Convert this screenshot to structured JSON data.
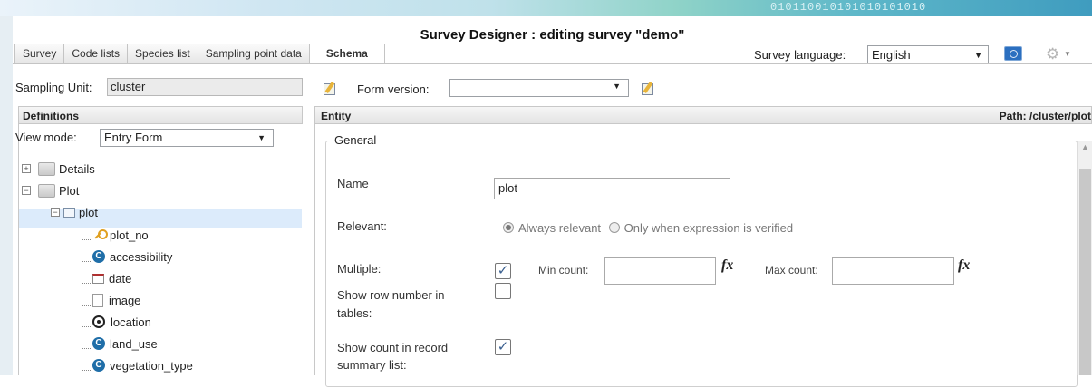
{
  "banner": {
    "digits": "010110010101010101010"
  },
  "window_title": "Survey Designer : editing survey \"demo\"",
  "tabs": [
    {
      "label": "Survey"
    },
    {
      "label": "Code lists"
    },
    {
      "label": "Species list"
    },
    {
      "label": "Sampling point data"
    },
    {
      "label": "Schema"
    }
  ],
  "active_tab": "Schema",
  "language": {
    "label": "Survey language:",
    "value": "English"
  },
  "sampling_unit": {
    "label": "Sampling Unit:",
    "value": "cluster"
  },
  "form_version": {
    "label": "Form version:",
    "value": ""
  },
  "definitions": {
    "header": "Definitions",
    "view_mode_label": "View mode:",
    "view_mode_value": "Entry Form",
    "tree": {
      "details": "Details",
      "plot_group": "Plot",
      "plot_entity": "plot",
      "children": [
        "plot_no",
        "accessibility",
        "date",
        "image",
        "location",
        "land_use",
        "vegetation_type"
      ],
      "child_icons": [
        "key-icon",
        "code-icon",
        "date-icon",
        "file-icon",
        "location-icon",
        "code-icon",
        "code-icon"
      ]
    }
  },
  "entity": {
    "header": "Entity",
    "path": "Path: /cluster/plot",
    "section": "General",
    "name_label": "Name",
    "name_value": "plot",
    "relevant_label": "Relevant:",
    "relevant_always": "Always relevant",
    "relevant_expr": "Only when expression is verified",
    "relevant_selected": "always",
    "multiple_label": "Multiple:",
    "multiple_checked": true,
    "min_count_label": "Min count:",
    "max_count_label": "Max count:",
    "fx": "fx",
    "show_row_number_label": [
      "Show row number in",
      "tables:"
    ],
    "show_row_number_checked": false,
    "show_count_label": [
      "Show count in record",
      "summary list:"
    ],
    "show_count_checked": true
  }
}
